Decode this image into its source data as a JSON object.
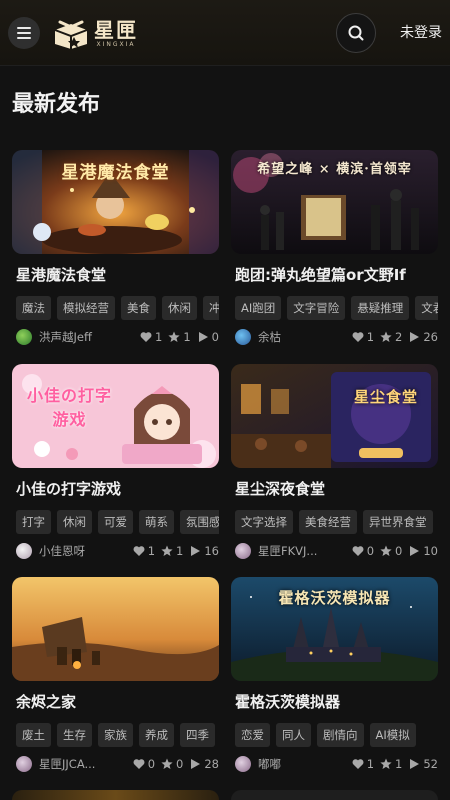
{
  "header": {
    "logo_main": "星匣",
    "logo_sub": "XINGXIA",
    "login_label": "未登录"
  },
  "section_title": "最新发布",
  "colors": {
    "background": "#121212",
    "tag_bg": "#2a2a2a",
    "text_primary": "#f0f0f0",
    "text_secondary": "#a8a8a8"
  },
  "cards": [
    {
      "title": "星港魔法食堂",
      "cover_caption": "星港魔法食堂",
      "tags": [
        "魔法",
        "模拟经营",
        "美食",
        "休闲",
        "冲"
      ],
      "author": "洪声越Jeff",
      "likes": "1",
      "stars": "1",
      "plays": "0"
    },
    {
      "title": "跑团:弹丸绝望篇or文野If",
      "cover_caption": "希望之峰 × 横滨·首领宰",
      "tags": [
        "AI跑团",
        "文字冒险",
        "悬疑推理",
        "文君"
      ],
      "author": "余枯",
      "likes": "1",
      "stars": "2",
      "plays": "26"
    },
    {
      "title": "小佳の打字游戏",
      "cover_caption": "小佳の打字游戏",
      "tags": [
        "打字",
        "休闲",
        "可爱",
        "萌系",
        "氛围感"
      ],
      "author": "小佳恩呀",
      "likes": "1",
      "stars": "1",
      "plays": "16"
    },
    {
      "title": "星尘深夜食堂",
      "cover_caption": "星尘食堂",
      "tags": [
        "文字选择",
        "美食经营",
        "异世界食堂"
      ],
      "author": "星匣FKVJ...",
      "likes": "0",
      "stars": "0",
      "plays": "10"
    },
    {
      "title": "余烬之家",
      "cover_caption": "",
      "tags": [
        "废土",
        "生存",
        "家族",
        "养成",
        "四季"
      ],
      "author": "星匣JJCA...",
      "likes": "0",
      "stars": "0",
      "plays": "28"
    },
    {
      "title": "霍格沃茨模拟器",
      "cover_caption": "霍格沃茨模拟器",
      "tags": [
        "恋爱",
        "同人",
        "剧情向",
        "AI模拟"
      ],
      "author": "嘟嘟",
      "likes": "1",
      "stars": "1",
      "plays": "52"
    }
  ]
}
